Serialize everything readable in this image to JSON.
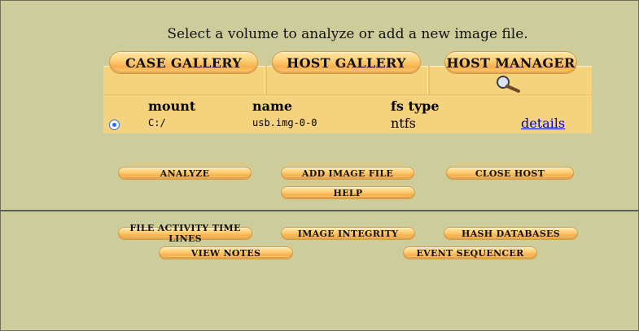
{
  "prompt": "Select a volume to analyze or add a new image file.",
  "tabs": {
    "case_gallery": "Case Gallery",
    "host_gallery": "Host Gallery",
    "host_manager": "Host Manager"
  },
  "table": {
    "headers": [
      "mount",
      "name",
      "fs type"
    ],
    "rows": [
      {
        "mount": "C:/",
        "name": "usb.img-0-0",
        "fs_type": "ntfs",
        "link": "details",
        "selected": true
      }
    ]
  },
  "actions": {
    "analyze": "Analyze",
    "add_image_file": "Add Image File",
    "close_host": "Close Host",
    "help": "Help"
  },
  "tools": {
    "file_activity": "File Activity Time Lines",
    "image_integrity": "Image Integrity",
    "hash_databases": "Hash Databases",
    "view_notes": "View Notes",
    "event_sequencer": "Event Sequencer"
  },
  "colors": {
    "background": "#cdcd9b",
    "panel": "#f5d37e",
    "button": "#f6b04e",
    "link": "#0000cc",
    "radio": "#2c6fd8"
  },
  "icons": {
    "host_manager_tab": "magnifier-icon"
  }
}
